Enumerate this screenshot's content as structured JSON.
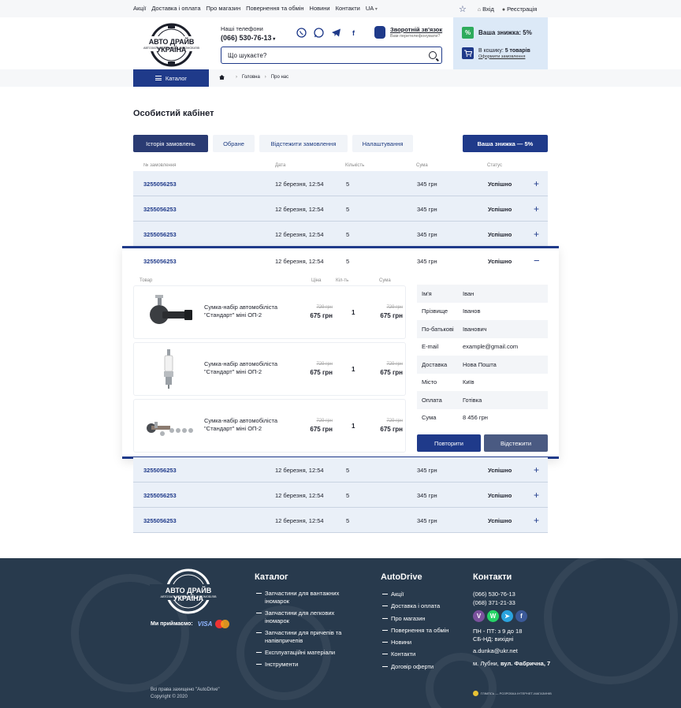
{
  "topnav": [
    "Акції",
    "Доставка і оплата",
    "Про магазин",
    "Повернення та обмін",
    "Новини",
    "Контакти",
    "UA"
  ],
  "auth": {
    "login": "Вхід",
    "register": "Реєстрація"
  },
  "logo": {
    "title": "АВТО ДРАЙВ УКРАЇНА",
    "subtitle": "АВТОЗАПЧАСТИНИ ДЛЯ АВТОМОБІЛІВ"
  },
  "phones": {
    "label": "Наші телефони",
    "number": "(066) 530-76-13"
  },
  "callback": {
    "title": "Зворотній зв'язок",
    "subtitle": "Вам перетелефонувати?"
  },
  "search": {
    "placeholder": "Що шукаєте?"
  },
  "promo": {
    "discount": "Ваша знижка: 5%",
    "cart_prefix": "В кошику: ",
    "cart_count": "5 товарів",
    "order_link": "Оформити замовлення"
  },
  "catalog": {
    "label": "Каталог"
  },
  "breadcrumb": {
    "home": "Головна",
    "current": "Про нас"
  },
  "page_title": "Особистий кабінет",
  "tabs": [
    "Історія замовлень",
    "Обране",
    "Відстежити замовлення",
    "Налаштування"
  ],
  "discount_button": "Ваша знижка — 5%",
  "table_headers": {
    "number": "№ замовлення",
    "date": "Дата",
    "qty": "Кількість",
    "sum": "Сума",
    "status": "Статус"
  },
  "orders_top": [
    {
      "number": "3255056253",
      "date": "12 березня, 12:54",
      "qty": "5",
      "sum": "345 грн",
      "status": "Успішно"
    },
    {
      "number": "3255056253",
      "date": "12 березня, 12:54",
      "qty": "5",
      "sum": "345 грн",
      "status": "Успішно"
    },
    {
      "number": "3255056253",
      "date": "12 березня, 12:54",
      "qty": "5",
      "sum": "345 грн",
      "status": "Успішно"
    }
  ],
  "expanded": {
    "number": "3255056253",
    "date": "12 березня, 12:54",
    "qty": "5",
    "sum": "345 грн",
    "status": "Успішно",
    "product_headers": {
      "product": "Товар",
      "price": "Ціна",
      "qty": "Кіл-ть",
      "sum": "Сума"
    },
    "products": [
      {
        "name": "Сумка-набір автомобіліста \"Стандарт\" міні ОП-2",
        "old_price": "729 грн",
        "price": "675 грн",
        "qty": "1",
        "old_sum": "729 грн",
        "sum": "675 грн",
        "icon": "tie-rod-end-icon"
      },
      {
        "name": "Сумка-набір автомобіліста \"Стандарт\" міні ОП-2",
        "old_price": "729 грн",
        "price": "675 грн",
        "qty": "1",
        "old_sum": "729 грн",
        "sum": "675 грн",
        "icon": "spark-plug-icon"
      },
      {
        "name": "Сумка-набір автомобіліста \"Стандарт\" міні ОП-2",
        "old_price": "729 грн",
        "price": "675 грн",
        "qty": "1",
        "old_sum": "729 грн",
        "sum": "675 грн",
        "icon": "steering-rod-kit-icon"
      }
    ],
    "info": [
      {
        "key": "Ім'я",
        "value": "Іван"
      },
      {
        "key": "Прізвище",
        "value": "Іванов"
      },
      {
        "key": "По-батькові",
        "value": "Іванович"
      },
      {
        "key": "E-mail",
        "value": "example@gmail.com"
      },
      {
        "key": "Доставка",
        "value": "Нова Пошта"
      },
      {
        "key": "Місто",
        "value": "Київ"
      },
      {
        "key": "Оплата",
        "value": "Готівка"
      },
      {
        "key": "Сума",
        "value": "8 456 грн"
      }
    ],
    "repeat_button": "Повторити",
    "track_button": "Відстежити"
  },
  "orders_bottom": [
    {
      "number": "3255056253",
      "date": "12 березня, 12:54",
      "qty": "5",
      "sum": "345 грн",
      "status": "Успішно"
    },
    {
      "number": "3255056253",
      "date": "12 березня, 12:54",
      "qty": "5",
      "sum": "345 грн",
      "status": "Успішно"
    },
    {
      "number": "3255056253",
      "date": "12 березня, 12:54",
      "qty": "5",
      "sum": "345 грн",
      "status": "Успішно"
    }
  ],
  "footer": {
    "pay_label": "Ми приймаємо:",
    "pay_visa": "VISA",
    "catalog_title": "Каталог",
    "catalog_items": [
      "Запчастини для вантажних іномарок",
      "Запчастини для легкових іномарок",
      "Запчастини для причепів та напівпричепів",
      "Експлуатаційні матеріали",
      "Інструменти"
    ],
    "autodrive_title": "AutoDrive",
    "autodrive_items": [
      "Акції",
      "Доставка і оплата",
      "Про магазин",
      "Повернення та обмін",
      "Новини",
      "Контакти",
      "Договір оферти"
    ],
    "contacts_title": "Контакти",
    "phone1": "(066) 530-76-13",
    "phone2": "(068) 371-21-33",
    "hours1": "ПН - ПТ: з 9 до 18",
    "hours2": "СБ-НД: вихідні",
    "email": "a.dunka@ukr.net",
    "address_city": "м. Лубни, ",
    "address_street": "вул. Фабрична, 7",
    "copyright1": "Всі права захищено \"AutoDrive\"",
    "copyright2": "Copyright © 2020",
    "developer": "ГЛІМПСЬ — РОЗРОБКА ІНТЕРНЕТ-МАГАЗИНІВ"
  },
  "colors": {
    "primary": "#1f3a8a",
    "dark_tab": "#2a3b73",
    "row_bg": "#eaf0f8",
    "promo_bg": "#dce9f7",
    "discount_badge": "#2eab5c",
    "footer_bg": "#283a4d"
  }
}
